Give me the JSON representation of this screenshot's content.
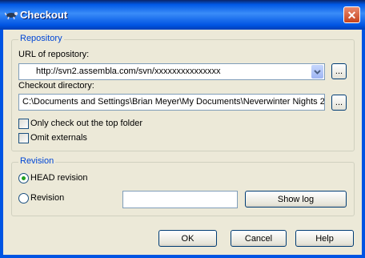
{
  "window": {
    "title": "Checkout",
    "close_glyph": "✕"
  },
  "repository_group": {
    "legend": "Repository",
    "url_label": "URL of repository:",
    "url_value": "http://svn2.assembla.com/svn/xxxxxxxxxxxxxxx",
    "checkout_dir_label": "Checkout directory:",
    "checkout_dir_value": "C:\\Documents and Settings\\Brian Meyer\\My Documents\\Neverwinter Nights 2",
    "browse_label": "...",
    "only_top_folder_label": "Only check out the top folder",
    "only_top_folder_checked": false,
    "omit_externals_label": "Omit externals",
    "omit_externals_checked": false
  },
  "revision_group": {
    "legend": "Revision",
    "head_revision_label": "HEAD revision",
    "head_revision_selected": true,
    "revision_label": "Revision",
    "revision_selected": false,
    "revision_value": "",
    "show_log_label": "Show log"
  },
  "buttons": {
    "ok": "OK",
    "cancel": "Cancel",
    "help": "Help"
  },
  "colors": {
    "title_bar": "#0054e3",
    "dialog_bg": "#ece9d8",
    "legend_text": "#0046d5",
    "close_button": "#c6421c"
  }
}
